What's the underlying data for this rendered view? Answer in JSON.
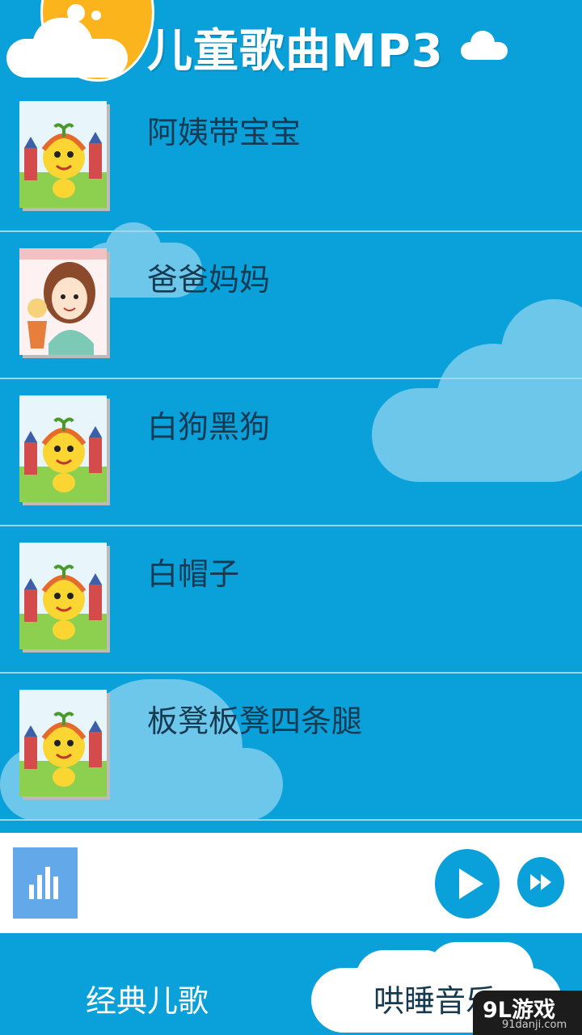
{
  "app": {
    "title": "儿童歌曲MP3"
  },
  "songs": [
    {
      "title": "阿姨带宝宝",
      "cover": "cartoon-mascot"
    },
    {
      "title": "爸爸妈妈",
      "cover": "girl-with-doll"
    },
    {
      "title": "白狗黑狗",
      "cover": "cartoon-mascot"
    },
    {
      "title": "白帽子",
      "cover": "cartoon-mascot"
    },
    {
      "title": "板凳板凳四条腿",
      "cover": "cartoon-mascot"
    }
  ],
  "player": {
    "equalizer_icon": "equalizer-icon",
    "play_icon": "play-icon",
    "next_icon": "fast-forward-icon"
  },
  "tabs": [
    {
      "label": "经典儿歌"
    },
    {
      "label": "哄睡音乐"
    }
  ],
  "watermark": {
    "main": "9L游戏",
    "sub": "91danji.com"
  },
  "colors": {
    "background": "#0aa0d9",
    "title": "#ffffff",
    "song_text": "#163a52",
    "sun": "#fbb41c",
    "cloud": "#6cc7ea",
    "equalizer": "#63a8e8"
  }
}
